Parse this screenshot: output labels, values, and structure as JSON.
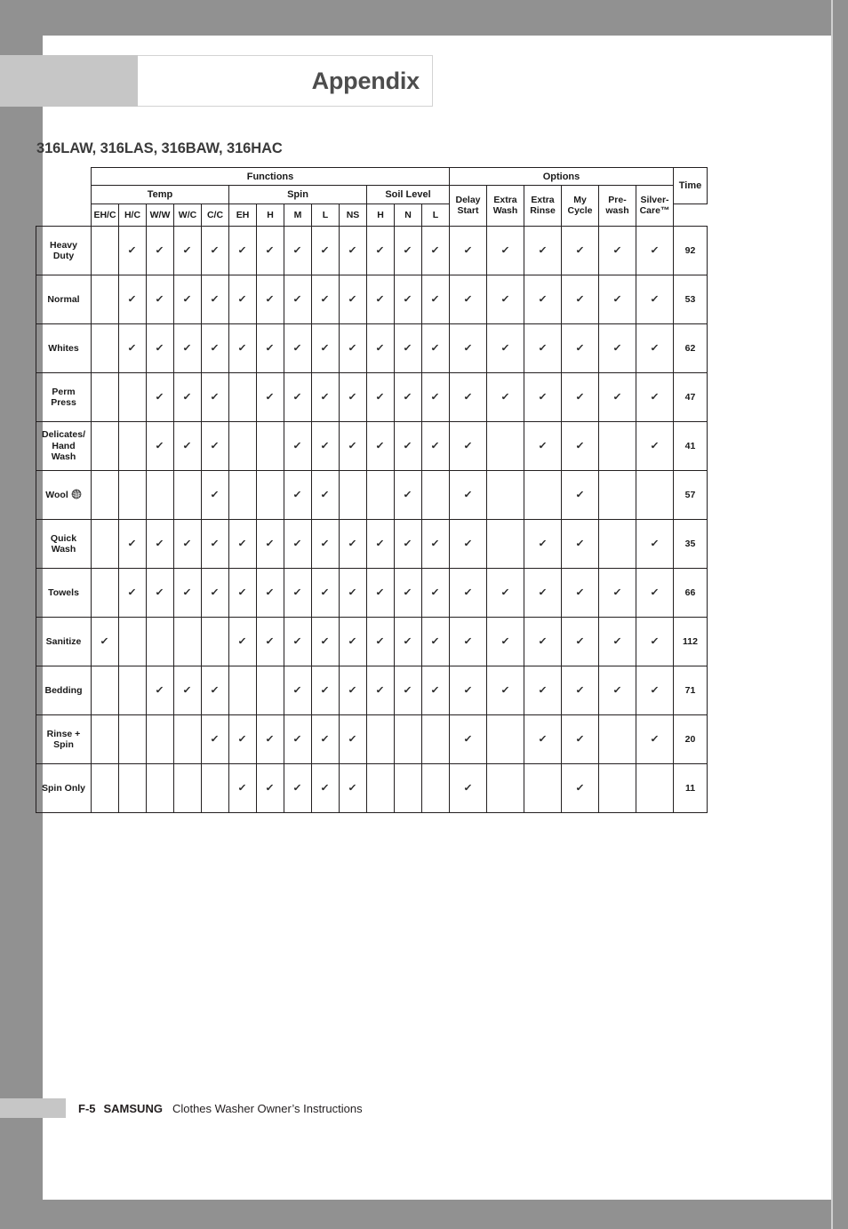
{
  "page": {
    "header_title": "Appendix",
    "models_title": "316LAW, 316LAS, 316BAW, 316HAC",
    "footer": {
      "page_number": "F-5",
      "brand": "SAMSUNG",
      "description": "Clothes Washer Owner’s Instructions"
    },
    "colors": {
      "outer_band": "#919191",
      "header_block": "#c6c6c6",
      "title_text": "#4d4d4d",
      "table_line": "#231f20"
    }
  },
  "table": {
    "group_headers": [
      {
        "label": "Functions",
        "span": 13
      },
      {
        "label": "Options",
        "span": 6
      },
      {
        "label": "Time",
        "span": 1
      }
    ],
    "sub_headers": [
      {
        "label": "Temp",
        "span": 5
      },
      {
        "label": "Spin",
        "span": 5
      },
      {
        "label": "Soil Level",
        "span": 3
      }
    ],
    "leaf_headers": [
      "EH/C",
      "H/C",
      "W/W",
      "W/C",
      "C/C",
      "EH",
      "H",
      "M",
      "L",
      "NS",
      "H",
      "N",
      "L"
    ],
    "option_headers": [
      "Delay Start",
      "Extra Wash",
      "Extra Rinse",
      "My Cycle",
      "Pre-wash",
      "Silver-Care™"
    ],
    "time_header": "Time",
    "check_glyph": "✓",
    "rows": [
      {
        "cycle": "Heavy Duty",
        "icon": null,
        "temp": [
          false,
          true,
          true,
          true,
          true
        ],
        "spin": [
          true,
          true,
          true,
          true,
          true
        ],
        "soil": [
          true,
          true,
          true
        ],
        "options": [
          true,
          true,
          true,
          true,
          true,
          true
        ],
        "time": "92"
      },
      {
        "cycle": "Normal",
        "icon": null,
        "temp": [
          false,
          true,
          true,
          true,
          true
        ],
        "spin": [
          true,
          true,
          true,
          true,
          true
        ],
        "soil": [
          true,
          true,
          true
        ],
        "options": [
          true,
          true,
          true,
          true,
          true,
          true
        ],
        "time": "53"
      },
      {
        "cycle": "Whites",
        "icon": null,
        "temp": [
          false,
          true,
          true,
          true,
          true
        ],
        "spin": [
          true,
          true,
          true,
          true,
          true
        ],
        "soil": [
          true,
          true,
          true
        ],
        "options": [
          true,
          true,
          true,
          true,
          true,
          true
        ],
        "time": "62"
      },
      {
        "cycle": "Perm Press",
        "icon": null,
        "temp": [
          false,
          false,
          true,
          true,
          true
        ],
        "spin": [
          false,
          true,
          true,
          true,
          true
        ],
        "soil": [
          true,
          true,
          true
        ],
        "options": [
          true,
          true,
          true,
          true,
          true,
          true
        ],
        "time": "47"
      },
      {
        "cycle": "Delicates/ Hand Wash",
        "icon": null,
        "temp": [
          false,
          false,
          true,
          true,
          true
        ],
        "spin": [
          false,
          false,
          true,
          true,
          true
        ],
        "soil": [
          true,
          true,
          true
        ],
        "options": [
          true,
          false,
          true,
          true,
          false,
          true
        ],
        "time": "41"
      },
      {
        "cycle": "Wool",
        "icon": "wool-ball-icon",
        "temp": [
          false,
          false,
          false,
          false,
          true
        ],
        "spin": [
          false,
          false,
          true,
          true,
          false
        ],
        "soil": [
          false,
          true,
          false
        ],
        "options": [
          true,
          false,
          false,
          true,
          false,
          false
        ],
        "time": "57"
      },
      {
        "cycle": "Quick Wash",
        "icon": null,
        "temp": [
          false,
          true,
          true,
          true,
          true
        ],
        "spin": [
          true,
          true,
          true,
          true,
          true
        ],
        "soil": [
          true,
          true,
          true
        ],
        "options": [
          true,
          false,
          true,
          true,
          false,
          true
        ],
        "time": "35"
      },
      {
        "cycle": "Towels",
        "icon": null,
        "temp": [
          false,
          true,
          true,
          true,
          true
        ],
        "spin": [
          true,
          true,
          true,
          true,
          true
        ],
        "soil": [
          true,
          true,
          true
        ],
        "options": [
          true,
          true,
          true,
          true,
          true,
          true
        ],
        "time": "66"
      },
      {
        "cycle": "Sanitize",
        "icon": null,
        "temp": [
          true,
          false,
          false,
          false,
          false
        ],
        "spin": [
          true,
          true,
          true,
          true,
          true
        ],
        "soil": [
          true,
          true,
          true
        ],
        "options": [
          true,
          true,
          true,
          true,
          true,
          true
        ],
        "time": "112"
      },
      {
        "cycle": "Bedding",
        "icon": null,
        "temp": [
          false,
          false,
          true,
          true,
          true
        ],
        "spin": [
          false,
          false,
          true,
          true,
          true
        ],
        "soil": [
          true,
          true,
          true
        ],
        "options": [
          true,
          true,
          true,
          true,
          true,
          true
        ],
        "time": "71"
      },
      {
        "cycle": "Rinse + Spin",
        "icon": null,
        "temp": [
          false,
          false,
          false,
          false,
          true
        ],
        "spin": [
          true,
          true,
          true,
          true,
          true
        ],
        "soil": [
          false,
          false,
          false
        ],
        "options": [
          true,
          false,
          true,
          true,
          false,
          true
        ],
        "time": "20"
      },
      {
        "cycle": "Spin Only",
        "icon": null,
        "temp": [
          false,
          false,
          false,
          false,
          false
        ],
        "spin": [
          true,
          true,
          true,
          true,
          true
        ],
        "soil": [
          false,
          false,
          false
        ],
        "options": [
          true,
          false,
          false,
          true,
          false,
          false
        ],
        "time": "11"
      }
    ]
  }
}
